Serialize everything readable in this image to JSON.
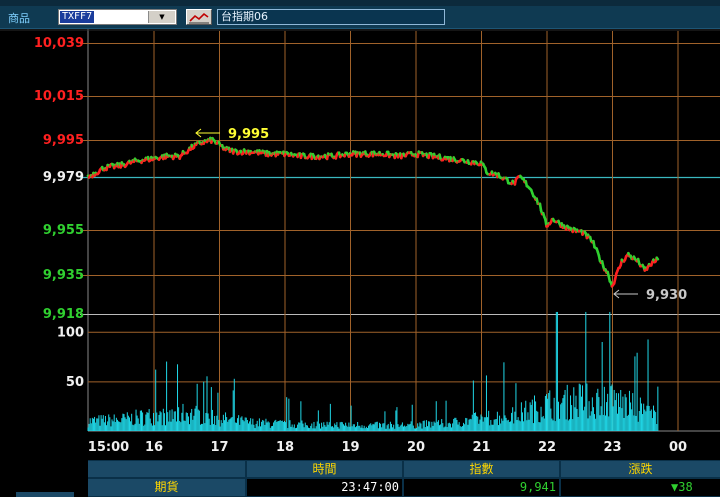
{
  "toolbar": {
    "product_label": "商品",
    "product_code": "TXFF7",
    "product_name": "台指期06"
  },
  "colors": {
    "up": "#ff2020",
    "down": "#30d030",
    "neutral": "#f0f0f0",
    "reference_line": "#3ab8c0",
    "volume": "#20d8e8",
    "grid": "#a0622a",
    "annotation_high": "#ffff33",
    "annotation_low": "#c8c8c8"
  },
  "chart_data": {
    "type": "line",
    "x_ticks": [
      "15:00",
      "16",
      "17",
      "18",
      "19",
      "20",
      "21",
      "22",
      "23",
      "00"
    ],
    "y_ticks": [
      {
        "label": "10,039",
        "value": 10039,
        "color": "up"
      },
      {
        "label": "10,015",
        "value": 10015,
        "color": "up"
      },
      {
        "label": "9,995",
        "value": 9995,
        "color": "up"
      },
      {
        "label": "9,979",
        "value": 9979,
        "color": "neutral"
      },
      {
        "label": "9,955",
        "value": 9955,
        "color": "down"
      },
      {
        "label": "9,935",
        "value": 9935,
        "color": "down"
      },
      {
        "label": "9,918",
        "value": 9918,
        "color": "down"
      }
    ],
    "reference_value": 9979,
    "x_range_hours": [
      15,
      24
    ],
    "price": [
      [
        15.0,
        9979
      ],
      [
        15.25,
        9983
      ],
      [
        15.5,
        9984
      ],
      [
        15.75,
        9986
      ],
      [
        16.0,
        9987
      ],
      [
        16.2,
        9988
      ],
      [
        16.4,
        9988
      ],
      [
        16.5,
        9990
      ],
      [
        16.6,
        9992
      ],
      [
        16.75,
        9994
      ],
      [
        16.9,
        9995
      ],
      [
        17.0,
        9993
      ],
      [
        17.1,
        9991
      ],
      [
        17.25,
        9990
      ],
      [
        17.5,
        9990
      ],
      [
        17.75,
        9989
      ],
      [
        18.0,
        9989
      ],
      [
        18.25,
        9988
      ],
      [
        18.5,
        9988
      ],
      [
        18.75,
        9988
      ],
      [
        19.0,
        9989
      ],
      [
        19.25,
        9989
      ],
      [
        19.5,
        9989
      ],
      [
        19.75,
        9988
      ],
      [
        20.0,
        9989
      ],
      [
        20.25,
        9988
      ],
      [
        20.5,
        9987
      ],
      [
        20.75,
        9986
      ],
      [
        21.0,
        9985
      ],
      [
        21.1,
        9981
      ],
      [
        21.25,
        9980
      ],
      [
        21.5,
        9976
      ],
      [
        21.6,
        9979
      ],
      [
        21.75,
        9974
      ],
      [
        21.9,
        9966
      ],
      [
        22.0,
        9957
      ],
      [
        22.1,
        9960
      ],
      [
        22.25,
        9957
      ],
      [
        22.4,
        9955
      ],
      [
        22.55,
        9954
      ],
      [
        22.7,
        9950
      ],
      [
        22.85,
        9940
      ],
      [
        22.95,
        9935
      ],
      [
        23.0,
        9930
      ],
      [
        23.15,
        9941
      ],
      [
        23.25,
        9944
      ],
      [
        23.4,
        9941
      ],
      [
        23.5,
        9937
      ],
      [
        23.6,
        9940
      ],
      [
        23.7,
        9942
      ]
    ],
    "price_annotations": [
      {
        "label": "9,995",
        "x": 16.9,
        "value": 9995,
        "side": "right",
        "color": "annotation_high"
      },
      {
        "label": "9,930",
        "x": 23.0,
        "value": 9930,
        "side": "right",
        "color": "annotation_low"
      }
    ],
    "volume_ticks": [
      {
        "label": "100",
        "value": 100
      },
      {
        "label": "50",
        "value": 50
      }
    ],
    "volume_max": 126,
    "volume_profile": [
      [
        15.0,
        14
      ],
      [
        15.5,
        16
      ],
      [
        16.0,
        22
      ],
      [
        16.25,
        20
      ],
      [
        16.5,
        26
      ],
      [
        16.75,
        22
      ],
      [
        17.0,
        18
      ],
      [
        17.5,
        12
      ],
      [
        18.0,
        10
      ],
      [
        18.5,
        9
      ],
      [
        19.0,
        9
      ],
      [
        19.5,
        8
      ],
      [
        20.0,
        9
      ],
      [
        20.5,
        11
      ],
      [
        21.0,
        18
      ],
      [
        21.5,
        22
      ],
      [
        21.75,
        30
      ],
      [
        22.0,
        38
      ],
      [
        22.25,
        40
      ],
      [
        22.5,
        44
      ],
      [
        22.75,
        42
      ],
      [
        23.0,
        46
      ],
      [
        23.25,
        36
      ],
      [
        23.5,
        30
      ],
      [
        23.7,
        20
      ]
    ]
  },
  "quote": {
    "headers": {
      "time": "時間",
      "index": "指數",
      "change": "漲跌"
    },
    "row_label": "期貨",
    "time": "23:47:00",
    "price": "9,941",
    "change_arrow": "▼",
    "change": "38"
  }
}
